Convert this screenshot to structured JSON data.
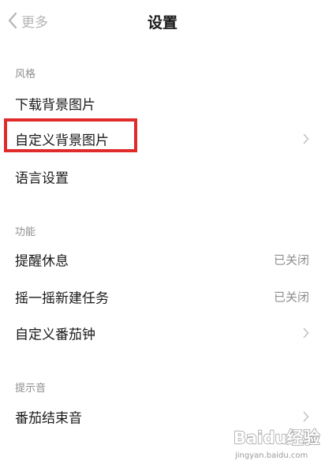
{
  "nav": {
    "back_label": "更多",
    "title": "设置"
  },
  "sections": {
    "style": {
      "header": "风格"
    },
    "function": {
      "header": "功能"
    },
    "sound": {
      "header": "提示音"
    }
  },
  "rows": {
    "download_bg": {
      "label": "下载背景图片"
    },
    "custom_bg": {
      "label": "自定义背景图片"
    },
    "language": {
      "label": "语言设置"
    },
    "rest_reminder": {
      "label": "提醒休息",
      "value": "已关闭"
    },
    "shake_new_task": {
      "label": "摇一摇新建任务",
      "value": "已关闭"
    },
    "custom_pomodoro": {
      "label": "自定义番茄钟"
    },
    "pomodoro_end_sound": {
      "label": "番茄结束音"
    }
  },
  "watermark": {
    "brand": "Baidu经验",
    "url": "jingyan.baidu.com"
  },
  "colors": {
    "highlight": "#e02b2b",
    "secondary_text": "#8e8e8e",
    "back_text": "#b5b5b5"
  }
}
